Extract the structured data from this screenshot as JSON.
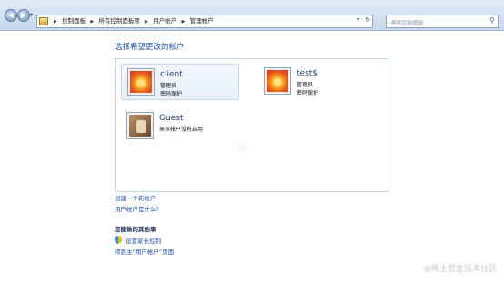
{
  "address_bar": {
    "breadcrumbs": [
      "控制面板",
      "所有控制面板项",
      "用户帐户",
      "管理帐户"
    ],
    "search_placeholder": "搜索控制面板"
  },
  "page": {
    "heading": "选择希望更改的帐户"
  },
  "accounts": [
    {
      "name": "client",
      "line1": "管理员",
      "line2": "密码保护"
    },
    {
      "name": "test$",
      "line1": "管理员",
      "line2": "密码保护"
    },
    {
      "name": "Guest",
      "line1": "来宾帐户没有启用",
      "line2": ""
    }
  ],
  "links": {
    "create_account": "创建一个新帐户",
    "what_is_account": "用户帐户是什么?"
  },
  "additional": {
    "heading": "您能做的其他事",
    "parental_controls": "设置家长控制",
    "goto_main": "转到主“用户帐户”页面"
  },
  "watermark": "@稀土掘金技术社区",
  "colors": {
    "link": "#1c4fa6",
    "heading": "#1e4f9c"
  }
}
